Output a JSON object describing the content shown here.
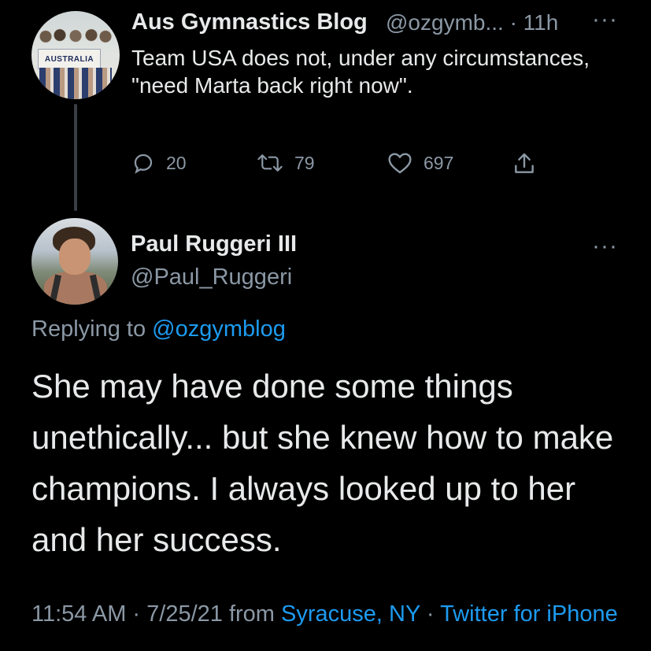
{
  "parent_tweet": {
    "author_name": "Aus Gymnastics Blog",
    "meta": "@ozgymb... · 11h",
    "more": "···",
    "avatar_banner_text": "AUSTRALIA",
    "text": "Team USA does not, under any circumstances, \"need Marta back right now\".",
    "replies_count": "20",
    "retweets_count": "79",
    "likes_count": "697"
  },
  "reply_tweet": {
    "author_name": "Paul Ruggeri III",
    "handle": "@Paul_Ruggeri",
    "more": "···",
    "replying_prefix": "Replying to",
    "replying_mention": "@ozgymblog",
    "text": "She may have done some things unethically... but she knew how to make champions. I always looked up to her and her success.",
    "time": "11:54 AM · 7/25/21",
    "from_label": "from",
    "location": "Syracuse, NY",
    "separator": "·",
    "source": "Twitter for iPhone"
  },
  "colors": {
    "background": "#000000",
    "primary_text": "#e7e9ea",
    "secondary_text": "#8b98a5",
    "link": "#1d9bf0"
  },
  "icons": [
    "reply-icon",
    "retweet-icon",
    "like-icon",
    "share-icon",
    "more-icon"
  ]
}
